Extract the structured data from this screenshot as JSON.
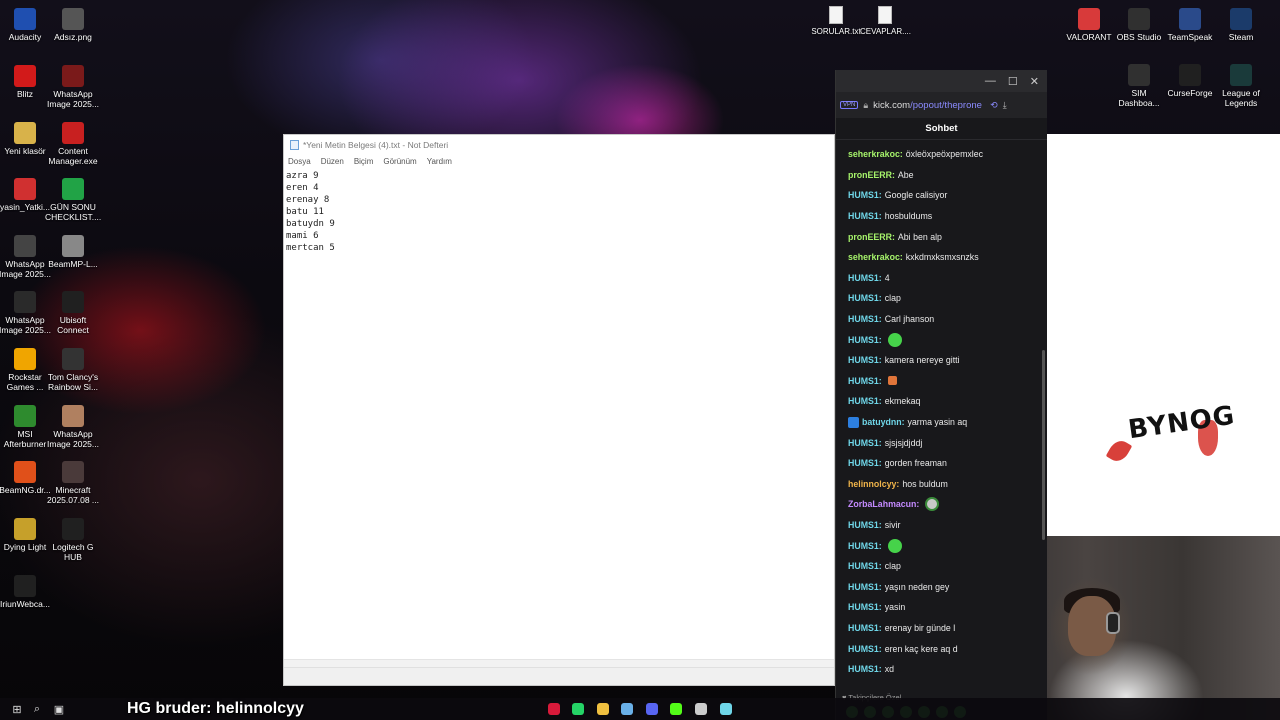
{
  "desktop": {
    "left_icons": [
      {
        "label": "Audacity",
        "icon": "audacity-icon",
        "color": "#1f4fb0"
      },
      {
        "label": "Adsız.png",
        "icon": "image-file-icon",
        "color": "#555555"
      },
      {
        "label": "Blitz",
        "icon": "blitz-icon",
        "color": "#d21a1a"
      },
      {
        "label": "WhatsApp Image 2025...",
        "icon": "image-file-icon",
        "color": "#7a1a1a"
      },
      {
        "label": "Yeni klasör",
        "icon": "folder-icon",
        "color": "#d8b24a"
      },
      {
        "label": "Content Manager.exe",
        "icon": "content-manager-icon",
        "color": "#c82020"
      },
      {
        "label": "yasin_Yatki...",
        "icon": "pdf-icon",
        "color": "#d03030"
      },
      {
        "label": "GÜN SONU CHECKLIST....",
        "icon": "sheet-icon",
        "color": "#21a346"
      },
      {
        "label": "WhatsApp Image 2025...",
        "icon": "image-file-icon",
        "color": "#444444"
      },
      {
        "label": "BeamMP-L...",
        "icon": "file-icon",
        "color": "#888888"
      },
      {
        "label": "WhatsApp Image 2025...",
        "icon": "image-file-icon",
        "color": "#2a2a2a"
      },
      {
        "label": "Ubisoft Connect",
        "icon": "ubisoft-icon",
        "color": "#202020"
      },
      {
        "label": "Rockstar Games ...",
        "icon": "rockstar-icon",
        "color": "#f0a500"
      },
      {
        "label": "Tom Clancy's Rainbow Si...",
        "icon": "rainbow-six-icon",
        "color": "#333333"
      },
      {
        "label": "MSI Afterburner",
        "icon": "msi-icon",
        "color": "#2e8b2e"
      },
      {
        "label": "WhatsApp Image 2025...",
        "icon": "image-file-icon",
        "color": "#b08060"
      },
      {
        "label": "BeamNG.dr...",
        "icon": "beamng-icon",
        "color": "#e0501a"
      },
      {
        "label": "Minecraft 2025.07.08 ...",
        "icon": "image-file-icon",
        "color": "#4a3a3a"
      },
      {
        "label": "Dying Light",
        "icon": "dying-light-icon",
        "color": "#c6a02a"
      },
      {
        "label": "Logitech G HUB",
        "icon": "logitech-icon",
        "color": "#202020"
      },
      {
        "label": "IriunWebca...",
        "icon": "webcam-icon",
        "color": "#202020"
      }
    ],
    "top_files": [
      {
        "label": "SORULAR.txt"
      },
      {
        "label": "CEVAPLAR...."
      }
    ],
    "right_icons": [
      {
        "label": "VALORANT",
        "icon": "valorant-icon",
        "color": "#d83a3a"
      },
      {
        "label": "OBS Studio",
        "icon": "obs-icon",
        "color": "#303030"
      },
      {
        "label": "TeamSpeak",
        "icon": "teamspeak-icon",
        "color": "#2a4a8a"
      },
      {
        "label": "Steam",
        "icon": "steam-icon",
        "color": "#1b3b6a"
      },
      {
        "label": "SIM Dashboa...",
        "icon": "sim-dashboard-icon",
        "color": "#303030"
      },
      {
        "label": "CurseForge",
        "icon": "curseforge-icon",
        "color": "#202020"
      },
      {
        "label": "League of Legends",
        "icon": "league-icon",
        "color": "#1a3a3a"
      }
    ]
  },
  "notepad": {
    "title": "*Yeni Metin Belgesi (4).txt - Not Defteri",
    "menu": [
      "Dosya",
      "Düzen",
      "Biçim",
      "Görünüm",
      "Yardım"
    ],
    "content": "azra 9\neren 4\nerenay 8\nbatu 11\nbatuydn 9\nmami 6\nmertcan 5"
  },
  "chat": {
    "url_domain": "kick.com",
    "url_path": "/popout/theprone",
    "vpn_label": "VPN",
    "header": "Sohbet",
    "messages": [
      {
        "user": "seherkrakoc:",
        "text": "öxleöxpeöxpemxlec",
        "color": "#a6f36b"
      },
      {
        "user": "pronEERR:",
        "text": "Abe",
        "color": "#a6f36b"
      },
      {
        "user": "HUMS1:",
        "text": "Google calisiyor",
        "color": "#6fd6e8"
      },
      {
        "user": "HUMS1:",
        "text": "hosbuldums",
        "color": "#6fd6e8"
      },
      {
        "user": "pronEERR:",
        "text": "Abi ben alp",
        "color": "#a6f36b"
      },
      {
        "user": "seherkrakoc:",
        "text": "kxkdmxksmxsnzks",
        "color": "#a6f36b"
      },
      {
        "user": "HUMS1:",
        "text": "4",
        "color": "#6fd6e8"
      },
      {
        "user": "HUMS1:",
        "text": "clap",
        "color": "#6fd6e8"
      },
      {
        "user": "HUMS1:",
        "text": "Carl jhanson",
        "color": "#6fd6e8"
      },
      {
        "user": "HUMS1:",
        "text": "",
        "emote": "green",
        "color": "#6fd6e8"
      },
      {
        "user": "HUMS1:",
        "text": "kamera nereye gitti",
        "color": "#6fd6e8"
      },
      {
        "user": "HUMS1:",
        "text": "",
        "emote": "small",
        "color": "#6fd6e8"
      },
      {
        "user": "HUMS1:",
        "text": "ekmekaq",
        "color": "#6fd6e8"
      },
      {
        "user": "batuydnn:",
        "text": "yarma yasin aq",
        "color": "#6fd6e8",
        "badge": true
      },
      {
        "user": "HUMS1:",
        "text": "sjsjsjdjddj",
        "color": "#6fd6e8"
      },
      {
        "user": "HUMS1:",
        "text": "gorden freaman",
        "color": "#6fd6e8"
      },
      {
        "user": "helinnolcyy:",
        "text": "hos buldum",
        "color": "#f0b44a"
      },
      {
        "user": "ZorbaLahmacun:",
        "text": "",
        "emote": "alien",
        "color": "#c48aff"
      },
      {
        "user": "HUMS1:",
        "text": "sivir",
        "color": "#6fd6e8"
      },
      {
        "user": "HUMS1:",
        "text": "",
        "emote": "green",
        "color": "#6fd6e8"
      },
      {
        "user": "HUMS1:",
        "text": "clap",
        "color": "#6fd6e8"
      },
      {
        "user": "HUMS1:",
        "text": "yaşın neden gey",
        "color": "#6fd6e8"
      },
      {
        "user": "HUMS1:",
        "text": "yasin",
        "color": "#6fd6e8"
      },
      {
        "user": "HUMS1:",
        "text": "erenay bir günde l",
        "color": "#6fd6e8"
      },
      {
        "user": "HUMS1:",
        "text": "eren kaç kere aq d",
        "color": "#6fd6e8"
      },
      {
        "user": "HUMS1:",
        "text": "xd",
        "color": "#6fd6e8"
      }
    ],
    "followers_label": "♥ Takipçilere Özel"
  },
  "logo_text": "BYNOG",
  "overlay_text": "HG bruder: helinnolcyy",
  "taskbar": {
    "apps": [
      {
        "icon": "opera-gx-icon",
        "color": "#d81a3a"
      },
      {
        "icon": "whatsapp-icon",
        "color": "#25d366"
      },
      {
        "icon": "file-explorer-icon",
        "color": "#f0c040"
      },
      {
        "icon": "steam-icon",
        "color": "#6ab0e8"
      },
      {
        "icon": "discord-icon",
        "color": "#5865f2"
      },
      {
        "icon": "kick-icon",
        "color": "#53fc18"
      },
      {
        "icon": "obs-icon",
        "color": "#cccccc"
      },
      {
        "icon": "notepad-icon",
        "color": "#6fd6e8"
      }
    ]
  }
}
